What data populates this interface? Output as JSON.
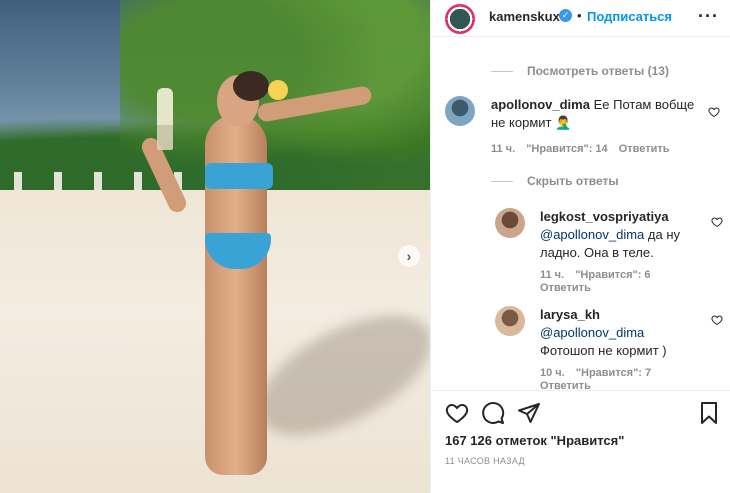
{
  "header": {
    "username": "kamenskux",
    "follow_label": "Подписаться",
    "dot": "•",
    "more": "···"
  },
  "replies_view": {
    "label": "Посмотреть ответы (13)"
  },
  "replies_hide": {
    "label": "Скрыть ответы"
  },
  "comment_main": {
    "user": "apollonov_dima",
    "text_line1": "Ее Потам вобще",
    "text_line2": "не кормит 🤦‍♂️",
    "time": "11 ч.",
    "likes": "\"Нравится\": 14",
    "reply": "Ответить"
  },
  "reply1": {
    "user": "legkost_vospriyatiya",
    "mention": "@apollonov_dima",
    "text_a": "да ну",
    "text_b": "ладно. Она в теле.",
    "time": "11 ч.",
    "likes": "\"Нравится\": 6",
    "reply": "Ответить"
  },
  "reply2": {
    "user": "larysa_kh",
    "mention": "@apollonov_dima",
    "text": "Фотошоп не кормит )",
    "time": "10 ч.",
    "likes": "\"Нравится\": 7",
    "reply": "Ответить"
  },
  "footer": {
    "likes_count": "167 126 отметок \"Нравится\"",
    "time_ago": "11 часов назад"
  },
  "icons": [
    "heart-icon",
    "comment-icon",
    "share-icon",
    "bookmark-icon",
    "verified-icon",
    "chevron-right-icon"
  ],
  "colors": {
    "link_blue": "#0095f6",
    "mention": "#00376b",
    "meta_gray": "#8e8e8e",
    "verified": "#3897f0"
  }
}
